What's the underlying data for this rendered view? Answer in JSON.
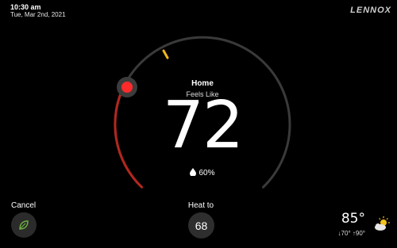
{
  "status": {
    "time": "10:30 am",
    "date": "Tue, Mar 2nd, 2021"
  },
  "brand": "LENNOX",
  "dial": {
    "mode": "Home",
    "feels_like_label": "Feels Like",
    "temperature": "72",
    "humidity": "60%",
    "colors": {
      "track": "#3a3a3a",
      "heat": "#b3261e",
      "knob": "#ff2b2b",
      "marker": "#f2b51c"
    }
  },
  "controls": {
    "cancel_label": "Cancel",
    "heat_to_label": "Heat to",
    "setpoint": "68"
  },
  "weather": {
    "temp": "85°",
    "low": "↓70°",
    "high": "↑90°",
    "icon": "partly-sunny-icon"
  }
}
